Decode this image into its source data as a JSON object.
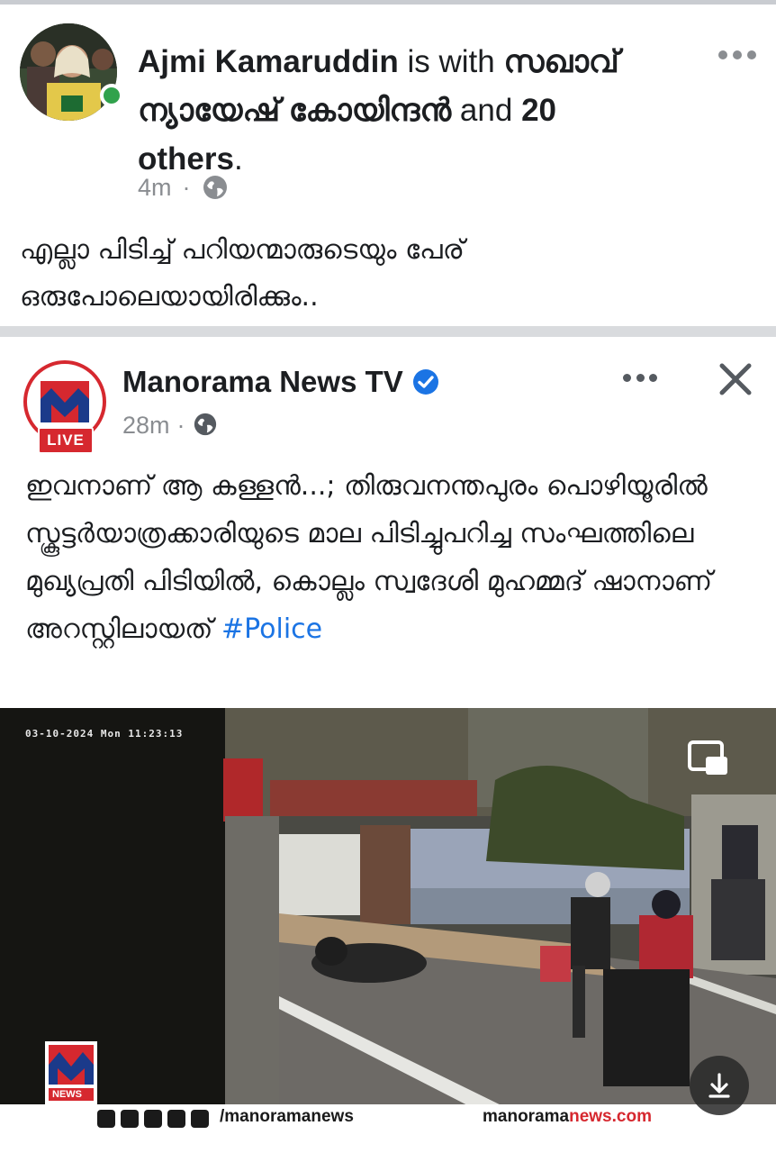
{
  "post": {
    "author": "Ajmi Kamaruddin",
    "with_text": "is with",
    "tagged": "സഖാവ് ന്യായേഷ് കോയിന്ദൻ",
    "and_text": "and",
    "others_count": "20",
    "others_label": "others",
    "time": "4m",
    "text_line1": "എല്ലാ പിടിച്ച് പറിയന്മാരുടെയും പേര്",
    "text_line2": "ഒരുപോലെയായിരിക്കും.."
  },
  "shared": {
    "page_name": "Manorama News TV",
    "live_label": "LIVE",
    "time": "28m",
    "text": "ഇവനാണ് ആ കള്ളൻ...; തിരുവനന്തപുരം പൊഴിയൂരിൽ സ്കൂട്ടർയാത്രക്കാരിയുടെ മാല പിടിച്ചുപറിച്ച സംഘത്തിലെ മുഖ്യപ്രതി പിടിയിൽ, കൊല്ലം സ്വദേശി മുഹമ്മദ് ഷാനാണ് അറസ്റ്റിലായത്",
    "hashtag": "#Police"
  },
  "video": {
    "timestamp": "03-10-2024 Mon 11:23:13",
    "social_handle": "/manoramanews",
    "site_url_prefix": "manorama",
    "site_url_suffix": "news.com",
    "logo_text": "NEWS"
  },
  "colors": {
    "link": "#1b74e4",
    "brand_red": "#d6282f",
    "online": "#31a24c",
    "meta_gray": "#8a8d91"
  },
  "icons": [
    "more-icon",
    "globe-icon",
    "verified-icon",
    "close-icon",
    "pip-icon",
    "download-icon"
  ]
}
